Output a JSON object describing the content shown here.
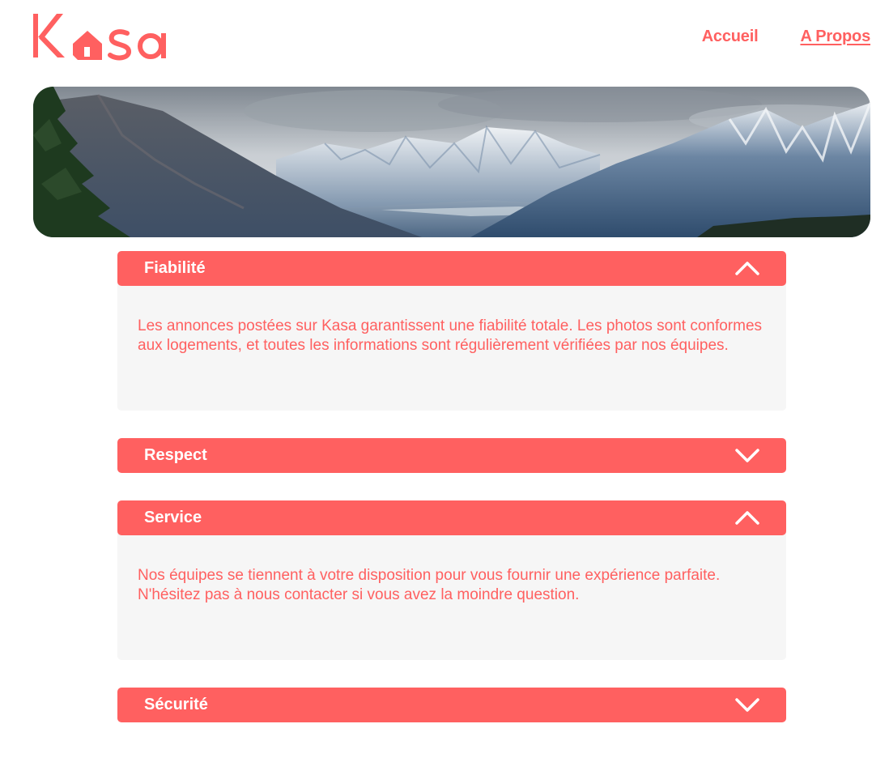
{
  "header": {
    "logo_text": "Kasa",
    "nav": [
      {
        "label": "Accueil",
        "active": false
      },
      {
        "label": "A Propos",
        "active": true
      }
    ]
  },
  "colors": {
    "primary": "#FF6060",
    "body_background": "#F6F6F6",
    "white": "#FFFFFF"
  },
  "banner": {
    "image": "mountain-landscape-banner"
  },
  "collapses": [
    {
      "title": "Fiabilité",
      "open": true,
      "icon": "chevron-up-icon",
      "content": "Les annonces postées sur Kasa garantissent une fiabilité totale. Les photos sont conformes aux logements, et toutes les informations sont régulièrement vérifiées par nos équipes."
    },
    {
      "title": "Respect",
      "open": false,
      "icon": "chevron-down-icon",
      "content": ""
    },
    {
      "title": "Service",
      "open": true,
      "icon": "chevron-up-icon",
      "content": "Nos équipes se tiennent à votre disposition pour vous fournir une expérience parfaite. N'hésitez pas à nous contacter si vous avez la moindre question."
    },
    {
      "title": "Sécurité",
      "open": false,
      "icon": "chevron-down-icon",
      "content": ""
    }
  ]
}
